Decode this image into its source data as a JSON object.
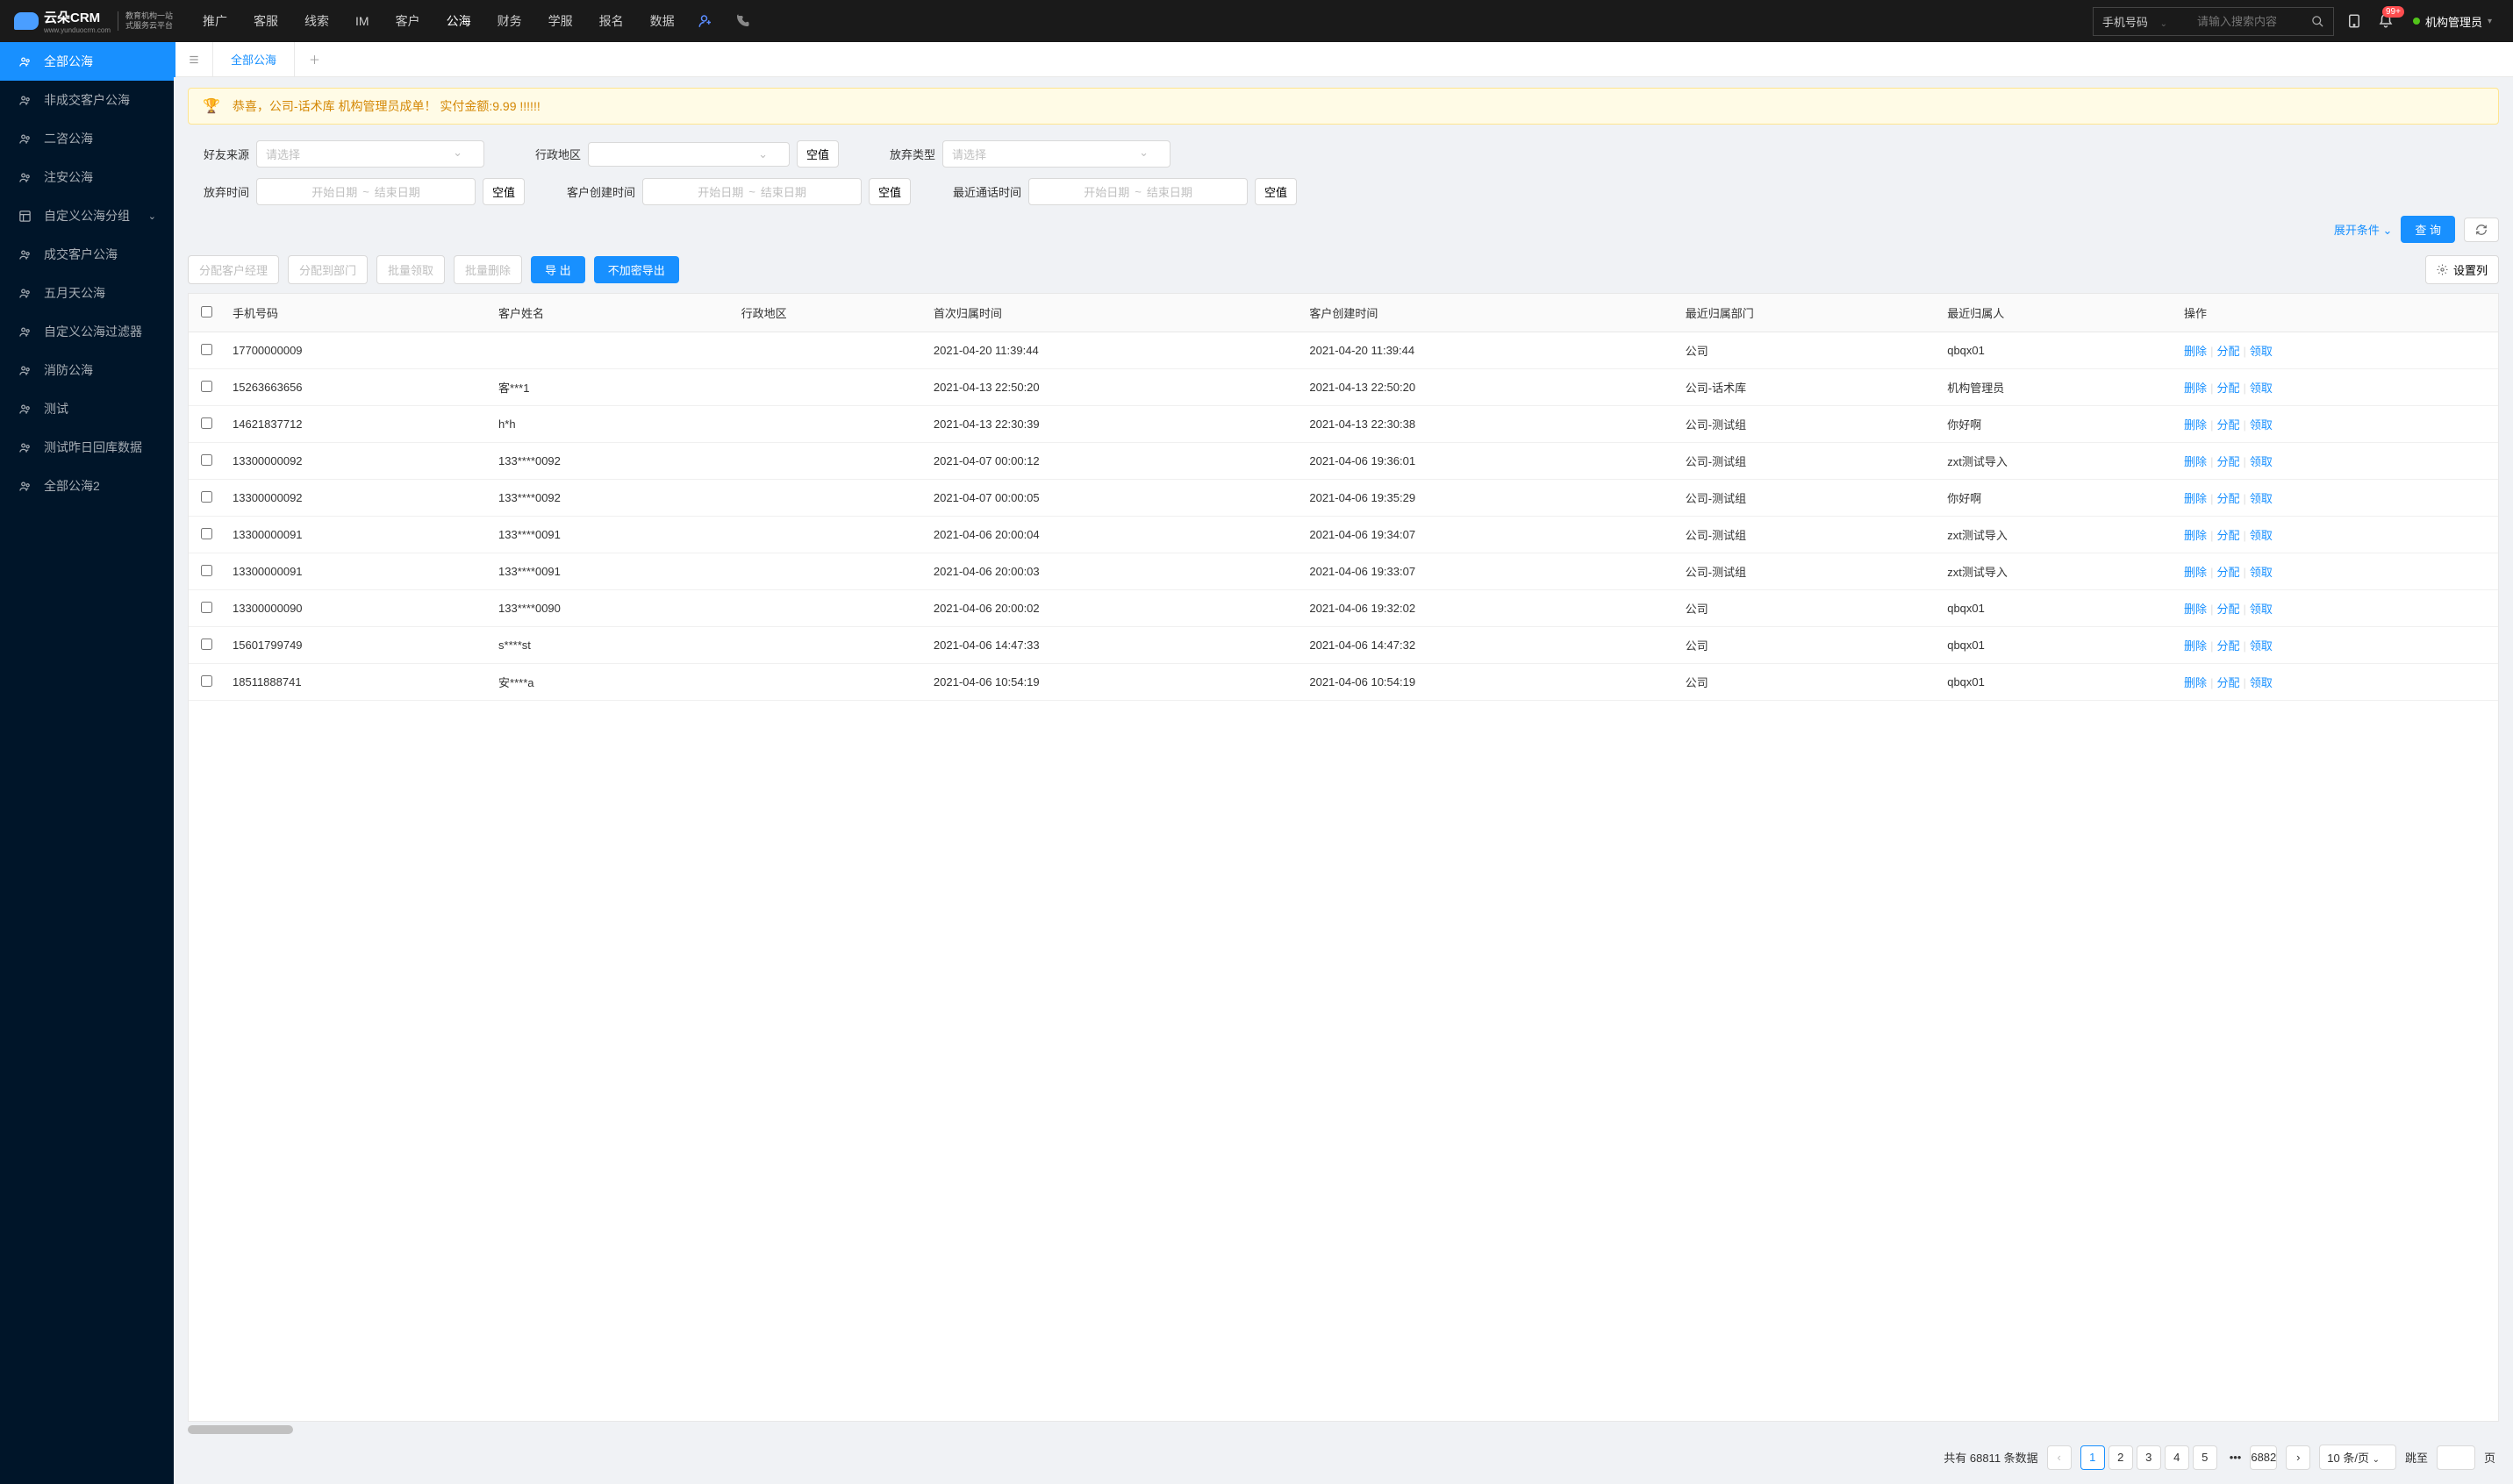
{
  "header": {
    "logo_text": "云朵CRM",
    "logo_sub1": "教育机构一站",
    "logo_sub2": "式服务云平台",
    "logo_url": "www.yunduocrm.com",
    "nav": [
      "推广",
      "客服",
      "线索",
      "IM",
      "客户",
      "公海",
      "财务",
      "学服",
      "报名",
      "数据"
    ],
    "nav_active": "公海",
    "search_type": "手机号码",
    "search_placeholder": "请输入搜索内容",
    "badge": "99+",
    "user_name": "机构管理员"
  },
  "sidebar": [
    {
      "label": "全部公海",
      "icon": "people",
      "active": true
    },
    {
      "label": "非成交客户公海",
      "icon": "people"
    },
    {
      "label": "二咨公海",
      "icon": "people"
    },
    {
      "label": "注安公海",
      "icon": "people"
    },
    {
      "label": "自定义公海分组",
      "icon": "layout",
      "chevron": true
    },
    {
      "label": "成交客户公海",
      "icon": "people"
    },
    {
      "label": "五月天公海",
      "icon": "people"
    },
    {
      "label": "自定义公海过滤器",
      "icon": "people"
    },
    {
      "label": "消防公海",
      "icon": "people"
    },
    {
      "label": "测试",
      "icon": "people"
    },
    {
      "label": "测试昨日回库数据",
      "icon": "people"
    },
    {
      "label": "全部公海2",
      "icon": "people"
    }
  ],
  "tabs": {
    "active": "全部公海"
  },
  "alert": "恭喜，公司-话术库  机构管理员成单！  实付金额:9.99 !!!!!!",
  "filters": {
    "friend_source": {
      "label": "好友来源",
      "placeholder": "请选择"
    },
    "region": {
      "label": "行政地区",
      "placeholder": "",
      "empty": "空值"
    },
    "abandon_type": {
      "label": "放弃类型",
      "placeholder": "请选择"
    },
    "abandon_time": {
      "label": "放弃时间",
      "start": "开始日期",
      "end": "结束日期",
      "empty": "空值"
    },
    "create_time": {
      "label": "客户创建时间",
      "start": "开始日期",
      "end": "结束日期",
      "empty": "空值"
    },
    "call_time": {
      "label": "最近通话时间",
      "start": "开始日期",
      "end": "结束日期",
      "empty": "空值"
    },
    "expand": "展开条件",
    "query": "查 询"
  },
  "toolbar": {
    "assign_mgr": "分配客户经理",
    "assign_dept": "分配到部门",
    "batch_claim": "批量领取",
    "batch_delete": "批量删除",
    "export": "导 出",
    "export_plain": "不加密导出",
    "settings": "设置列"
  },
  "table": {
    "columns": [
      "手机号码",
      "客户姓名",
      "行政地区",
      "首次归属时间",
      "客户创建时间",
      "最近归属部门",
      "最近归属人",
      "操作"
    ],
    "actions": {
      "delete": "删除",
      "assign": "分配",
      "claim": "领取"
    },
    "rows": [
      {
        "phone": "17700000009",
        "name": "",
        "region": "",
        "first_time": "2021-04-20 11:39:44",
        "create_time": "2021-04-20 11:39:44",
        "dept": "公司",
        "owner": "qbqx01"
      },
      {
        "phone": "15263663656",
        "name": "客***1",
        "region": "",
        "first_time": "2021-04-13 22:50:20",
        "create_time": "2021-04-13 22:50:20",
        "dept": "公司-话术库",
        "owner": "机构管理员"
      },
      {
        "phone": "14621837712",
        "name": "h*h",
        "region": "",
        "first_time": "2021-04-13 22:30:39",
        "create_time": "2021-04-13 22:30:38",
        "dept": "公司-测试组",
        "owner": "你好啊"
      },
      {
        "phone": "13300000092",
        "name": "133****0092",
        "region": "",
        "first_time": "2021-04-07 00:00:12",
        "create_time": "2021-04-06 19:36:01",
        "dept": "公司-测试组",
        "owner": "zxt测试导入"
      },
      {
        "phone": "13300000092",
        "name": "133****0092",
        "region": "",
        "first_time": "2021-04-07 00:00:05",
        "create_time": "2021-04-06 19:35:29",
        "dept": "公司-测试组",
        "owner": "你好啊"
      },
      {
        "phone": "13300000091",
        "name": "133****0091",
        "region": "",
        "first_time": "2021-04-06 20:00:04",
        "create_time": "2021-04-06 19:34:07",
        "dept": "公司-测试组",
        "owner": "zxt测试导入"
      },
      {
        "phone": "13300000091",
        "name": "133****0091",
        "region": "",
        "first_time": "2021-04-06 20:00:03",
        "create_time": "2021-04-06 19:33:07",
        "dept": "公司-测试组",
        "owner": "zxt测试导入"
      },
      {
        "phone": "13300000090",
        "name": "133****0090",
        "region": "",
        "first_time": "2021-04-06 20:00:02",
        "create_time": "2021-04-06 19:32:02",
        "dept": "公司",
        "owner": "qbqx01"
      },
      {
        "phone": "15601799749",
        "name": "s****st",
        "region": "",
        "first_time": "2021-04-06 14:47:33",
        "create_time": "2021-04-06 14:47:32",
        "dept": "公司",
        "owner": "qbqx01"
      },
      {
        "phone": "18511888741",
        "name": "安****a",
        "region": "",
        "first_time": "2021-04-06 10:54:19",
        "create_time": "2021-04-06 10:54:19",
        "dept": "公司",
        "owner": "qbqx01"
      }
    ]
  },
  "pagination": {
    "total_prefix": "共有",
    "total": "68811",
    "total_suffix": "条数据",
    "pages": [
      "1",
      "2",
      "3",
      "4",
      "5"
    ],
    "last": "6882",
    "page_size": "10 条/页",
    "jump_label": "跳至",
    "jump_suffix": "页"
  }
}
